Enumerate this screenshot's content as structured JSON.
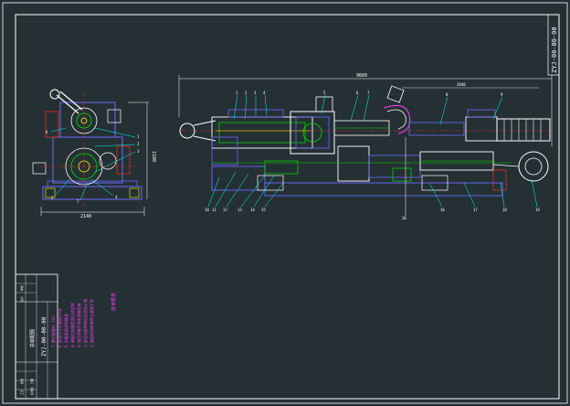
{
  "drawing": {
    "background": "#253034",
    "frame_color": "#ffffff",
    "magenta": "#ff3fff",
    "green": "#00e000",
    "blue": "#6a6aff",
    "cyan": "#00ffff",
    "yellow": "#ffff00",
    "red": "#ff2a2a",
    "code_vertical_top": "ZYJ-00-00-00",
    "code_vertical_bottom": "ZYJ-00-00-00",
    "dim_main_length": "9660",
    "dim_segment": "2040",
    "dim_side_width": "2140",
    "dim_side_depth": "1600",
    "dim_side_height": "1180",
    "balloons_main": [
      "1",
      "2",
      "3",
      "4",
      "5",
      "6",
      "7",
      "8",
      "9",
      "10",
      "11",
      "12",
      "13",
      "14",
      "15",
      "16",
      "17",
      "18",
      "19",
      "20"
    ],
    "balloons_side": [
      "1",
      "2",
      "3",
      "4",
      "5",
      "6",
      "7"
    ],
    "tech_requirements": {
      "title": "技术要求",
      "lines": [
        "1.装配前所有零件应清洗干净",
        "2.各运动部件转动灵活无卡滞",
        "3.液压系统不得有渗漏现象",
        "4.装配后按规定进行试运转",
        "5.外露表面涂防锈漆",
        "6.未注尺寸公差按IT14",
        "7.整机重量约 12t"
      ]
    },
    "title_block": {
      "name": "总装配图",
      "drawing_no": "ZYJ-00-00-00",
      "rows": [
        "设计",
        "审核",
        "工艺",
        "批准",
        "标准化",
        "日期"
      ]
    }
  }
}
